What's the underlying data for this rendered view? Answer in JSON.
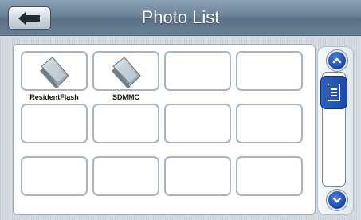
{
  "header": {
    "title": "Photo List",
    "back_icon": "back-arrow-icon"
  },
  "grid": {
    "items": [
      {
        "label": "ResidentFlash",
        "icon": "folder-icon"
      },
      {
        "label": "SDMMC",
        "icon": "folder-icon"
      },
      {
        "label": ""
      },
      {
        "label": ""
      },
      {
        "label": ""
      },
      {
        "label": ""
      },
      {
        "label": ""
      },
      {
        "label": ""
      },
      {
        "label": ""
      },
      {
        "label": ""
      },
      {
        "label": ""
      },
      {
        "label": ""
      }
    ]
  },
  "scrollbar": {
    "up_icon": "chevron-up-icon",
    "down_icon": "chevron-down-icon",
    "thumb_icon": "grip-icon",
    "accent": "#1f4fa8"
  }
}
